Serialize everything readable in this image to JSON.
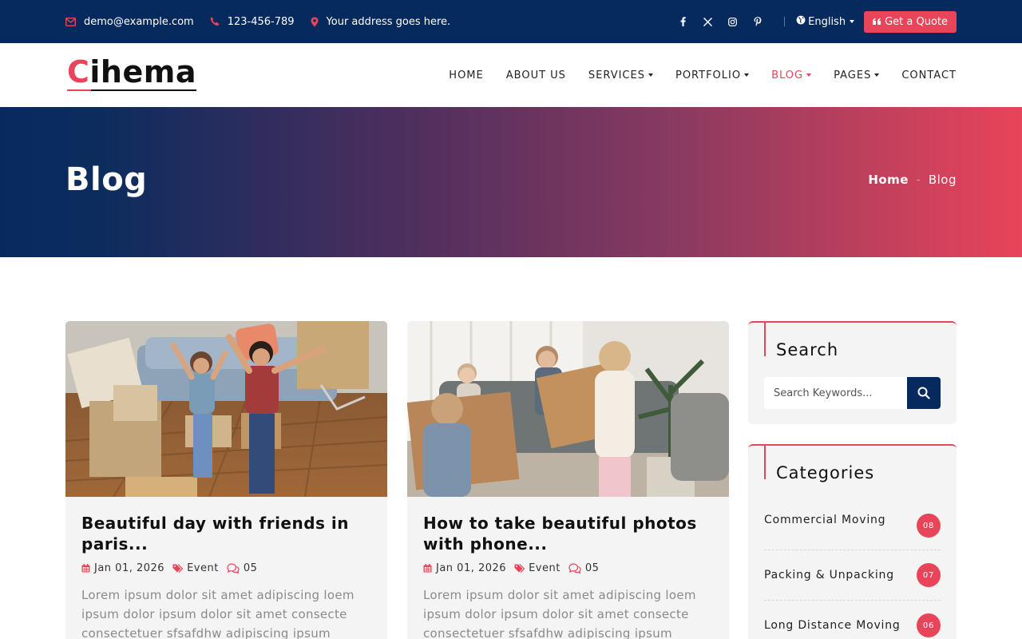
{
  "topbar": {
    "email": "demo@example.com",
    "phone": "123-456-789",
    "address": "Your address goes here.",
    "social": [
      "facebook-icon",
      "x-icon",
      "instagram-icon",
      "pinterest-icon"
    ],
    "language": "English",
    "quote_button": "Get a Quote",
    "colors": {
      "background": "#072a5e",
      "accent": "#e8445a"
    }
  },
  "header": {
    "logo_first": "C",
    "logo_rest": "ihema",
    "nav": [
      {
        "label": "HOME",
        "dropdown": false,
        "active": false
      },
      {
        "label": "ABOUT US",
        "dropdown": false,
        "active": false
      },
      {
        "label": "SERVICES",
        "dropdown": true,
        "active": false
      },
      {
        "label": "PORTFOLIO",
        "dropdown": true,
        "active": false
      },
      {
        "label": "BLOG",
        "dropdown": true,
        "active": true
      },
      {
        "label": "PAGES",
        "dropdown": true,
        "active": false
      },
      {
        "label": "CONTACT",
        "dropdown": false,
        "active": false
      }
    ]
  },
  "banner": {
    "title": "Blog",
    "breadcrumb": {
      "home": "Home",
      "separator": "-",
      "current": "Blog"
    }
  },
  "posts": [
    {
      "title": "Beautiful day with friends in paris...",
      "date": "Jan 01, 2026",
      "category": "Event",
      "comments": "05",
      "excerpt": "Lorem ipsum dolor sit amet adipiscing loem ipsum dolor ipsum dolor sit amet consecte consectetuer sfsafdhw adipiscing ipsum"
    },
    {
      "title": "How to take beautiful photos with phone...",
      "date": "Jan 01, 2026",
      "category": "Event",
      "comments": "05",
      "excerpt": "Lorem ipsum dolor sit amet adipiscing loem ipsum dolor ipsum dolor sit amet consecte consectetuer sfsafdhw adipiscing ipsum"
    }
  ],
  "sidebar": {
    "search": {
      "title": "Search",
      "placeholder": "Search Keywords..."
    },
    "categories": {
      "title": "Categories",
      "items": [
        {
          "label": "Commercial Moving",
          "count": "08"
        },
        {
          "label": "Packing & Unpacking",
          "count": "07"
        },
        {
          "label": "Long Distance Moving",
          "count": "06"
        }
      ]
    }
  }
}
